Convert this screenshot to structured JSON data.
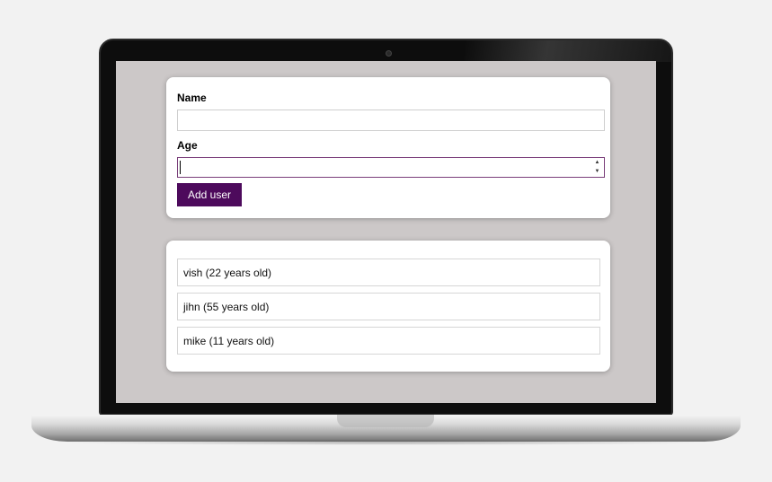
{
  "form": {
    "name_label": "Name",
    "name_value": "",
    "age_label": "Age",
    "age_value": "",
    "spinner_up": "▲",
    "spinner_down": "▼",
    "submit_label": "Add user"
  },
  "users": [
    {
      "text": "vish (22 years old)"
    },
    {
      "text": "jihn (55 years old)"
    },
    {
      "text": "mike (11 years old)"
    }
  ],
  "colors": {
    "button_bg": "#4d0a5c",
    "screen_bg": "#ccc8c8",
    "focus_border": "#7a3e7a"
  }
}
